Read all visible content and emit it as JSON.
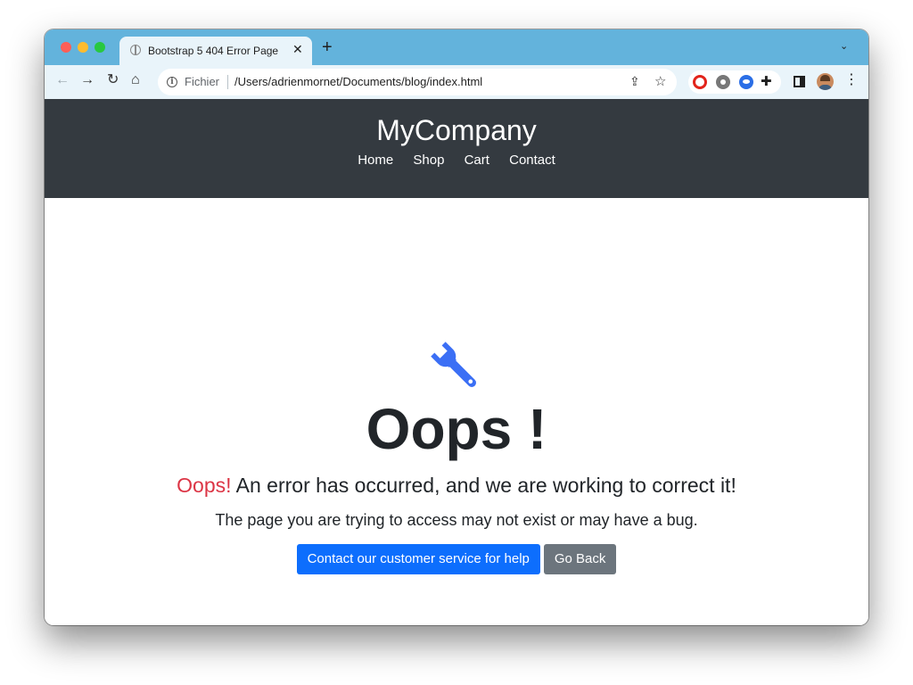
{
  "browser": {
    "tab_title": "Bootstrap 5 404 Error Page",
    "tab_close": "✕",
    "new_tab": "+",
    "tab_menu": "⌄",
    "url_scheme": "Fichier",
    "url_path": "/Users/adrienmornet/Documents/blog/index.html",
    "colors": {
      "tab_strip": "#63b3dc",
      "toolbar": "#e9f4fa"
    },
    "icons": [
      "back-icon",
      "forward-icon",
      "reload-icon",
      "home-icon",
      "info-icon",
      "share-icon",
      "star-icon",
      "opera-extension-icon",
      "gear-extension-icon",
      "eye-extension-icon",
      "puzzle-extension-icon",
      "side-panel-icon",
      "profile-avatar",
      "kebab-menu-icon"
    ]
  },
  "site": {
    "brand": "MyCompany",
    "nav": [
      "Home",
      "Shop",
      "Cart",
      "Contact"
    ],
    "header_color": "#343a40"
  },
  "error": {
    "icon": "wrench-icon",
    "icon_color": "#3b6ff5",
    "title": "Oops !",
    "lead_accent": "Oops!",
    "lead_text": " An error has occurred, and we are working to correct it!",
    "accent_color": "#dc3545",
    "sub_text": "The page you are trying to access may not exist or may have a bug.",
    "primary_button": "Contact our customer service for help",
    "secondary_button": "Go Back",
    "primary_color": "#0d6efd",
    "secondary_color": "#6c757d"
  }
}
